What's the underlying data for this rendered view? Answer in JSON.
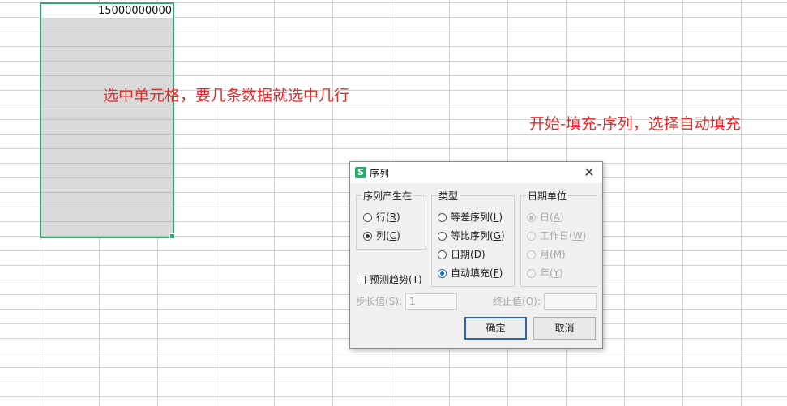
{
  "sheet": {
    "first_cell_value": "15000000000"
  },
  "annotations": {
    "left_note": "选中单元格，要几条数据就选中几行",
    "right_note": "开始-填充-序列，选择自动填充"
  },
  "dialog": {
    "icon_glyph": "S",
    "title": "序列",
    "close_glyph": "✕",
    "series_in": {
      "legend": "序列产生在",
      "options": [
        {
          "label": "行(",
          "key": "R",
          "suffix": ")",
          "selected": false
        },
        {
          "label": "列(",
          "key": "C",
          "suffix": ")",
          "selected": true
        }
      ]
    },
    "type": {
      "legend": "类型",
      "options": [
        {
          "label": "等差序列(",
          "key": "L",
          "suffix": ")",
          "selected": false
        },
        {
          "label": "等比序列(",
          "key": "G",
          "suffix": ")",
          "selected": false
        },
        {
          "label": "日期(",
          "key": "D",
          "suffix": ")",
          "selected": false
        },
        {
          "label": "自动填充(",
          "key": "F",
          "suffix": ")",
          "selected": true
        }
      ]
    },
    "date_unit": {
      "legend": "日期单位",
      "options": [
        {
          "label": "日(",
          "key": "A",
          "suffix": ")",
          "selected": true
        },
        {
          "label": "工作日(",
          "key": "W",
          "suffix": ")",
          "selected": false
        },
        {
          "label": "月(",
          "key": "M",
          "suffix": ")",
          "selected": false
        },
        {
          "label": "年(",
          "key": "Y",
          "suffix": ")",
          "selected": false
        }
      ]
    },
    "trend": {
      "label": "预测趋势(",
      "key": "T",
      "suffix": ")",
      "checked": false
    },
    "step": {
      "label": "步长值(",
      "key": "S",
      "suffix": "):",
      "value": "1"
    },
    "stop": {
      "label": "终止值(",
      "key": "O",
      "suffix": "):",
      "value": ""
    },
    "ok_label": "确定",
    "cancel_label": "取消"
  },
  "colors": {
    "selection_border": "#2fa86d",
    "annotation_text": "#e42b2b",
    "primary_button_border": "#2b63b8"
  }
}
